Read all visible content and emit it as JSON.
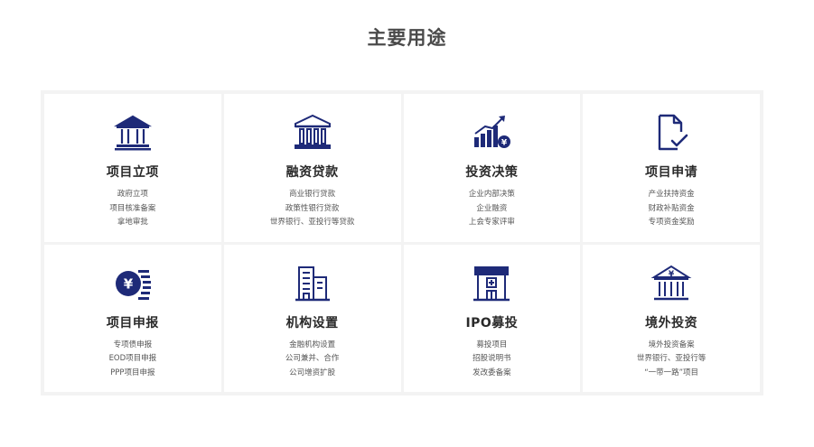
{
  "title": "主要用途",
  "colors": {
    "icon": "#1e2a78",
    "accent": "#1e2a78"
  },
  "cards": [
    {
      "icon": "bank-icon",
      "title": "项目立项",
      "items": [
        "政府立项",
        "项目核准备案",
        "拿地审批"
      ]
    },
    {
      "icon": "classical-bank-icon",
      "title": "融资贷款",
      "items": [
        "商业银行贷款",
        "政策性银行贷款",
        "世界银行、亚投行等贷款"
      ]
    },
    {
      "icon": "growth-chart-icon",
      "title": "投资决策",
      "items": [
        "企业内部决策",
        "企业融资",
        "上会专家评审"
      ]
    },
    {
      "icon": "document-check-icon",
      "title": "项目申请",
      "items": [
        "产业扶持资金",
        "财政补贴资金",
        "专项资金奖励"
      ]
    },
    {
      "icon": "yen-coin-icon",
      "title": "项目申报",
      "items": [
        "专项债申报",
        "EOD项目申报",
        "PPP项目申报"
      ]
    },
    {
      "icon": "buildings-icon",
      "title": "机构设置",
      "items": [
        "金融机构设置",
        "公司兼并、合作",
        "公司增资扩股"
      ]
    },
    {
      "icon": "hospital-icon",
      "title": "IPO募投",
      "items": [
        "募投项目",
        "招股说明书",
        "发改委备案"
      ]
    },
    {
      "icon": "yen-bank-icon",
      "title": "境外投资",
      "items": [
        "境外投资备案",
        "世界银行、亚投行等",
        "“一带一路”项目"
      ]
    }
  ]
}
